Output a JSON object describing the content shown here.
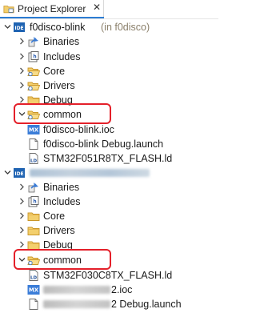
{
  "tab": {
    "title": "Project Explorer",
    "close_glyph": "✕"
  },
  "icons": {
    "chevron_expanded": "chevron-down-icon",
    "chevron_collapsed": "chevron-right-icon",
    "project": "ide-project-icon",
    "folder": "folder-icon",
    "binaries": "binaries-icon",
    "includes": "includes-icon",
    "mx": "mx-ioc-icon",
    "file": "file-icon",
    "ld": "ld-file-icon"
  },
  "colors": {
    "highlight": "#e4202a",
    "folder": "#e8b84a",
    "tab_accent": "#2b7cd3"
  },
  "project1": {
    "name": "f0disco-blink",
    "suffix": "(in f0disco)",
    "children": {
      "binaries": "Binaries",
      "includes": "Includes",
      "core": "Core",
      "drivers": "Drivers",
      "debug": "Debug",
      "common": "common",
      "ioc": "f0disco-blink.ioc",
      "launch": "f0disco-blink Debug.launch",
      "ld": "STM32F051R8TX_FLASH.ld"
    }
  },
  "project2": {
    "children": {
      "binaries": "Binaries",
      "includes": "Includes",
      "core": "Core",
      "drivers": "Drivers",
      "debug": "Debug",
      "common": "common",
      "ld": "STM32F030C8TX_FLASH.ld",
      "ioc_tail": "2.ioc",
      "launch_tail": "2 Debug.launch"
    }
  }
}
